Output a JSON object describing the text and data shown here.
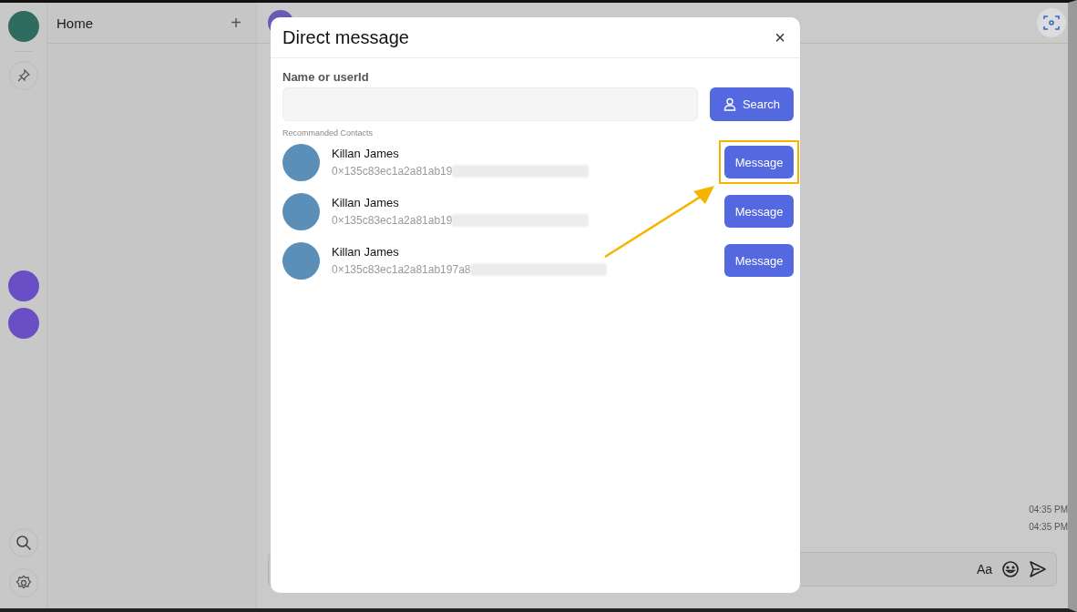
{
  "sidebar": {
    "title": "Home",
    "add_label": "+"
  },
  "chat": {
    "timestamps": [
      "04:35 PM",
      "04:35 PM"
    ],
    "composer": {
      "format_label": "Aa"
    }
  },
  "dialog": {
    "title": "Direct message",
    "close_label": "×",
    "search": {
      "label": "Name or userId",
      "button": "Search"
    },
    "section_label": "Recommanded Contacts",
    "contacts": [
      {
        "name": "Killan James",
        "address": "0×135c83ec1a2a81ab19",
        "redacted": true,
        "highlighted": true,
        "action": "Message"
      },
      {
        "name": "Killan James",
        "address": "0×135c83ec1a2a81ab19",
        "redacted": true,
        "highlighted": false,
        "action": "Message"
      },
      {
        "name": "Killan James",
        "address": "0×135c83ec1a2a81ab197a8",
        "redacted": true,
        "highlighted": false,
        "action": "Message"
      }
    ]
  }
}
